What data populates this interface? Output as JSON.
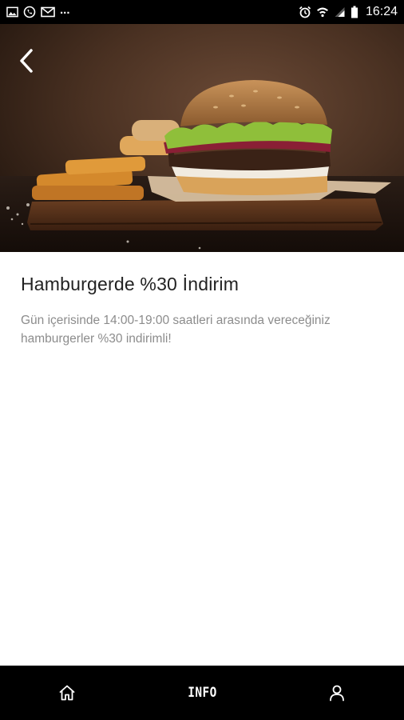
{
  "status_bar": {
    "left_icons": [
      "image-icon",
      "whatsapp-icon",
      "mail-icon"
    ],
    "overflow": "...",
    "right_icons": [
      "alarm-icon",
      "wifi-icon",
      "signal-icon",
      "battery-icon"
    ],
    "time": "16:24"
  },
  "hero": {
    "image": "burger-photo",
    "back_icon": "chevron-left-icon"
  },
  "campaign": {
    "title": "Hamburgerde %30 İndirim",
    "description": "Gün içerisinde 14:00-19:00 saatleri arasında vereceğiniz hamburgerler %30 indirimli!"
  },
  "bottom_nav": {
    "home_icon": "home-icon",
    "info_label": "INFO",
    "profile_icon": "user-icon"
  },
  "colors": {
    "bar_background": "#000000",
    "title_text": "#222222",
    "description_text": "#8c8c8c"
  }
}
